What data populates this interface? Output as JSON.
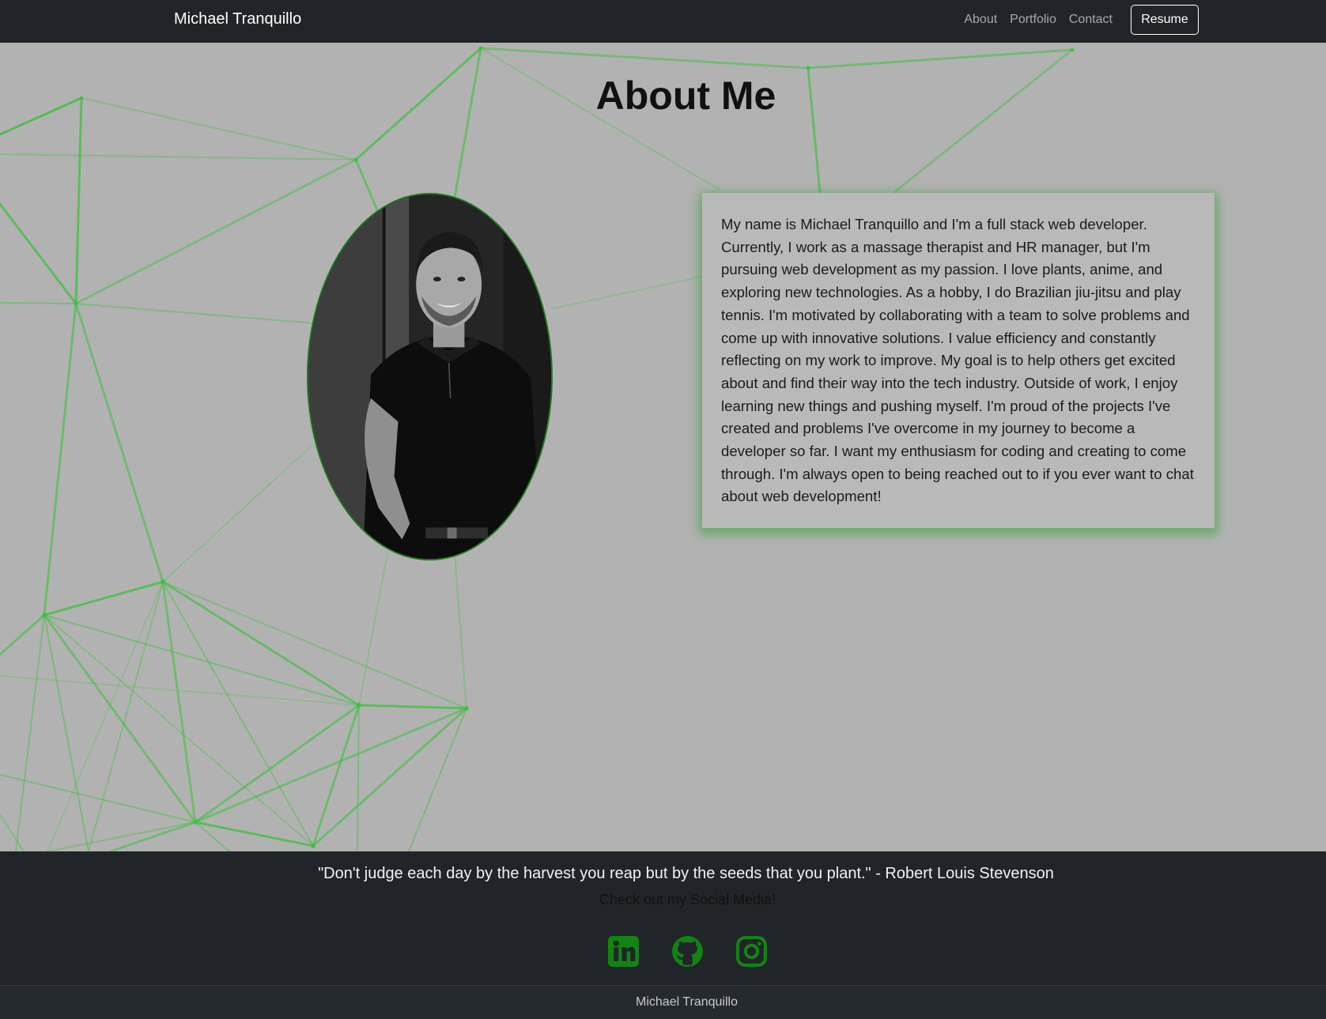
{
  "navbar": {
    "brand": "Michael Tranquillo",
    "links": [
      {
        "label": "About"
      },
      {
        "label": "Portfolio"
      },
      {
        "label": "Contact"
      }
    ],
    "resume_label": "Resume"
  },
  "main": {
    "title": "About Me",
    "bio": "My name is Michael Tranquillo and I'm a full stack web developer. Currently, I work as a massage therapist and HR manager, but I'm pursuing web development as my passion. I love plants, anime, and exploring new technologies. As a hobby, I do Brazilian jiu-jitsu and play tennis. I'm motivated by collaborating with a team to solve problems and come up with innovative solutions. I value efficiency and constantly reflecting on my work to improve. My goal is to help others get excited about and find their way into the tech industry. Outside of work, I enjoy learning new things and pushing myself. I'm proud of the projects I've created and problems I've overcome in my journey to become a developer so far. I want my enthusiasm for coding and creating to come through. I'm always open to being reached out to if you ever want to chat about web development!"
  },
  "footer": {
    "quote": "\"Don't judge each day by the harvest you reap but by the seeds that you plant.\" - Robert Louis Stevenson",
    "social_heading": "Check out my Social Media!",
    "social_links": [
      {
        "icon": "linkedin-icon"
      },
      {
        "icon": "github-icon"
      },
      {
        "icon": "instagram-icon"
      }
    ],
    "copyright": "Michael Tranquillo"
  },
  "colors": {
    "navbar_bg": "#212529",
    "page_bg": "#b2b2b2",
    "accent_green": "#1f8a1f",
    "line_green": "#3fbf3f"
  }
}
